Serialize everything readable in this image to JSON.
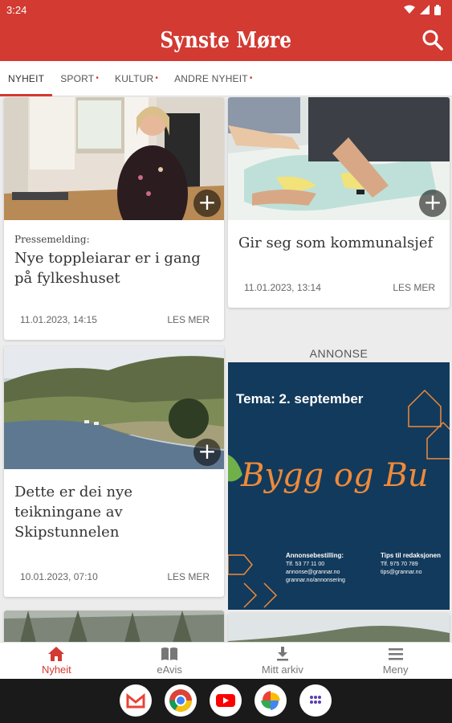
{
  "status": {
    "time": "3:24"
  },
  "app": {
    "title": "Synste Møre",
    "brand_color": "#d23a32"
  },
  "tabs": [
    {
      "label": "NYHEIT",
      "active": true,
      "dot": ""
    },
    {
      "label": "SPORT",
      "active": false,
      "dot": "•"
    },
    {
      "label": "KULTUR",
      "active": false,
      "dot": "•"
    },
    {
      "label": "ANDRE NYHEIT",
      "active": false,
      "dot": "•"
    }
  ],
  "articles": [
    {
      "kicker": "Pressemelding:",
      "title": "Nye toppleiarar er i gang på fylkeshuset",
      "date": "11.01.2023, 14:15",
      "read_more": "LES MER"
    },
    {
      "kicker": "",
      "title": "Gir seg som kommunalsjef",
      "date": "11.01.2023, 13:14",
      "read_more": "LES MER"
    },
    {
      "kicker": "",
      "title": "Dette er dei nye teikningane av Skipstunnelen",
      "date": "10.01.2023, 07:10",
      "read_more": "LES MER"
    }
  ],
  "ad": {
    "label": "ANNONSE",
    "headline": "Tema: 2. september",
    "script": "Bygg og Bu",
    "left_title": "Annonsebestilling:",
    "left_lines": [
      "Tlf. 53 77 11 00",
      "annonse@grannar.no",
      "grannar.no/annonsering"
    ],
    "right_title": "Tips til redaksjonen",
    "right_lines": [
      "Tlf. 975 70 789",
      "tips@grannar.no"
    ],
    "bg_color": "#123a5c",
    "accent_color": "#ef8a3a"
  },
  "bottom_nav": [
    {
      "label": "Nyheit",
      "icon": "home-icon",
      "active": true
    },
    {
      "label": "eAvis",
      "icon": "book-icon",
      "active": false
    },
    {
      "label": "Mitt arkiv",
      "icon": "download-icon",
      "active": false
    },
    {
      "label": "Meny",
      "icon": "menu-icon",
      "active": false
    }
  ],
  "dock": [
    "gmail-icon",
    "chrome-icon",
    "youtube-icon",
    "photos-icon",
    "apps-icon"
  ]
}
